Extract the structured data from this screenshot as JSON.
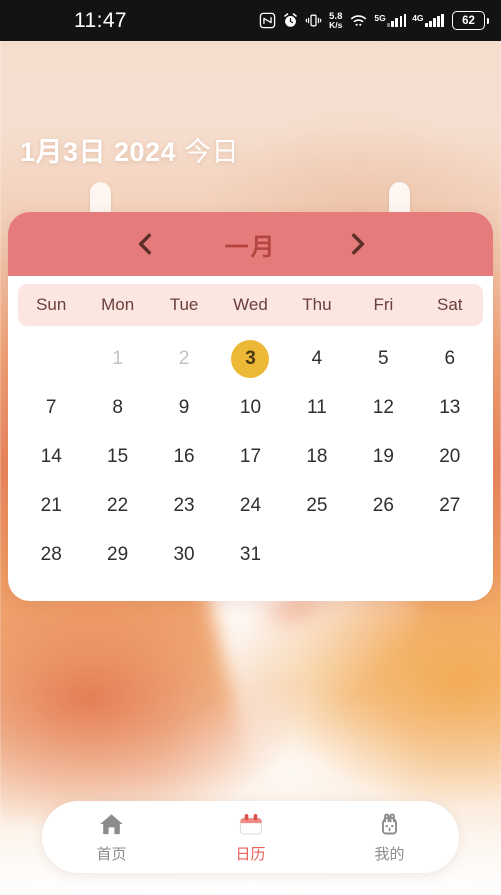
{
  "status_bar": {
    "time": "11:47",
    "network_speed_value": "5.8",
    "network_speed_unit": "K/s",
    "signal_primary_label": "5G",
    "signal_secondary_label": "4G",
    "battery_level": "62",
    "icons": [
      "nfc-icon",
      "alarm-icon",
      "vibrate-icon",
      "wifi-icon",
      "signal-icon",
      "battery-icon"
    ]
  },
  "header": {
    "date_text": "1月3日 2024",
    "today_label": "今日"
  },
  "calendar": {
    "prev_icon": "chevron-left-icon",
    "next_icon": "chevron-right-icon",
    "month_label": "一月",
    "weekdays": [
      "Sun",
      "Mon",
      "Tue",
      "Wed",
      "Thu",
      "Fri",
      "Sat"
    ],
    "leading_blanks": 1,
    "prev_month_days": [],
    "days": [
      {
        "n": "1",
        "state": "muted"
      },
      {
        "n": "2",
        "state": "muted"
      },
      {
        "n": "3",
        "state": "selected"
      },
      {
        "n": "4",
        "state": "normal"
      },
      {
        "n": "5",
        "state": "normal"
      },
      {
        "n": "6",
        "state": "normal"
      },
      {
        "n": "7",
        "state": "normal"
      },
      {
        "n": "8",
        "state": "normal"
      },
      {
        "n": "9",
        "state": "normal"
      },
      {
        "n": "10",
        "state": "normal"
      },
      {
        "n": "11",
        "state": "normal"
      },
      {
        "n": "12",
        "state": "normal"
      },
      {
        "n": "13",
        "state": "normal"
      },
      {
        "n": "14",
        "state": "normal"
      },
      {
        "n": "15",
        "state": "normal"
      },
      {
        "n": "16",
        "state": "normal"
      },
      {
        "n": "17",
        "state": "normal"
      },
      {
        "n": "18",
        "state": "normal"
      },
      {
        "n": "19",
        "state": "normal"
      },
      {
        "n": "20",
        "state": "normal"
      },
      {
        "n": "21",
        "state": "normal"
      },
      {
        "n": "22",
        "state": "normal"
      },
      {
        "n": "23",
        "state": "normal"
      },
      {
        "n": "24",
        "state": "normal"
      },
      {
        "n": "25",
        "state": "normal"
      },
      {
        "n": "26",
        "state": "normal"
      },
      {
        "n": "27",
        "state": "normal"
      },
      {
        "n": "28",
        "state": "normal"
      },
      {
        "n": "29",
        "state": "normal"
      },
      {
        "n": "30",
        "state": "normal"
      },
      {
        "n": "31",
        "state": "normal"
      }
    ]
  },
  "bottom_nav": {
    "items": [
      {
        "label": "首页",
        "icon": "home-icon",
        "active": false
      },
      {
        "label": "日历",
        "icon": "calendar-icon",
        "active": true
      },
      {
        "label": "我的",
        "icon": "rabbit-icon",
        "active": false
      }
    ]
  },
  "colors": {
    "month_bar": "#e67b7b",
    "month_label": "#b4453f",
    "selected_day": "#edb836",
    "weekday_strip": "#fbe6e2",
    "active_nav": "#e8605a",
    "inactive_nav": "#8c8c8c",
    "status_bar": "#131313"
  }
}
